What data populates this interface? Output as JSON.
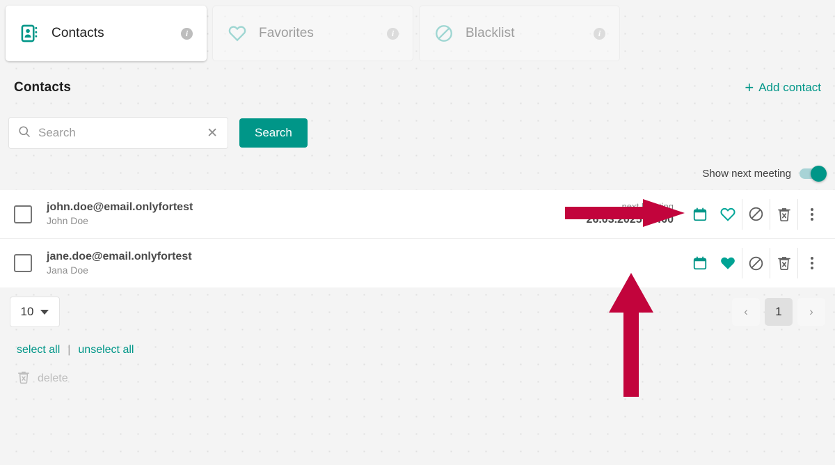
{
  "tabs": [
    {
      "id": "contacts",
      "label": "Contacts",
      "icon": "address-book-icon",
      "active": true,
      "info": "i"
    },
    {
      "id": "favorites",
      "label": "Favorites",
      "icon": "heart-outline-icon",
      "active": false,
      "info": "i"
    },
    {
      "id": "blacklist",
      "label": "Blacklist",
      "icon": "block-icon",
      "active": false,
      "info": "i"
    }
  ],
  "page": {
    "title": "Contacts",
    "add_contact_label": "Add contact",
    "add_contact_plus": "+"
  },
  "search": {
    "placeholder": "Search",
    "value": "",
    "clear_glyph": "✕",
    "button_label": "Search"
  },
  "toggle": {
    "label": "Show next meeting",
    "enabled": true
  },
  "contacts": [
    {
      "email": "john.doe@email.onlyfortest",
      "name": "John Doe",
      "checked": false,
      "meeting_label": "next Meeting",
      "meeting_value": "26.03.2025 13:00",
      "favorite": false
    },
    {
      "email": "jane.doe@email.onlyfortest",
      "name": "Jana Doe",
      "checked": false,
      "meeting_label": "",
      "meeting_value": "",
      "favorite": true
    }
  ],
  "row_actions": {
    "calendar": "calendar-icon",
    "favorite": "heart-icon",
    "block": "block-icon",
    "delete": "trash-x-icon",
    "more": "more-vertical-icon"
  },
  "footer": {
    "per_page": "10",
    "pager": {
      "prev_glyph": "‹",
      "pages": [
        "1"
      ],
      "current": "1",
      "next_glyph": "›"
    },
    "select_all_label": "select all",
    "separator": "|",
    "unselect_all_label": "unselect all",
    "delete_label": "delete"
  },
  "colors": {
    "accent": "#009688",
    "annotation": "#c2043c",
    "muted": "#9e9e9e",
    "surface": "#ffffff",
    "background": "#f4f4f4"
  },
  "annotations": [
    {
      "id": "arrow-to-toggle",
      "direction": "right",
      "color": "#c2043c"
    },
    {
      "id": "arrow-to-meeting",
      "direction": "up",
      "color": "#c2043c"
    }
  ]
}
